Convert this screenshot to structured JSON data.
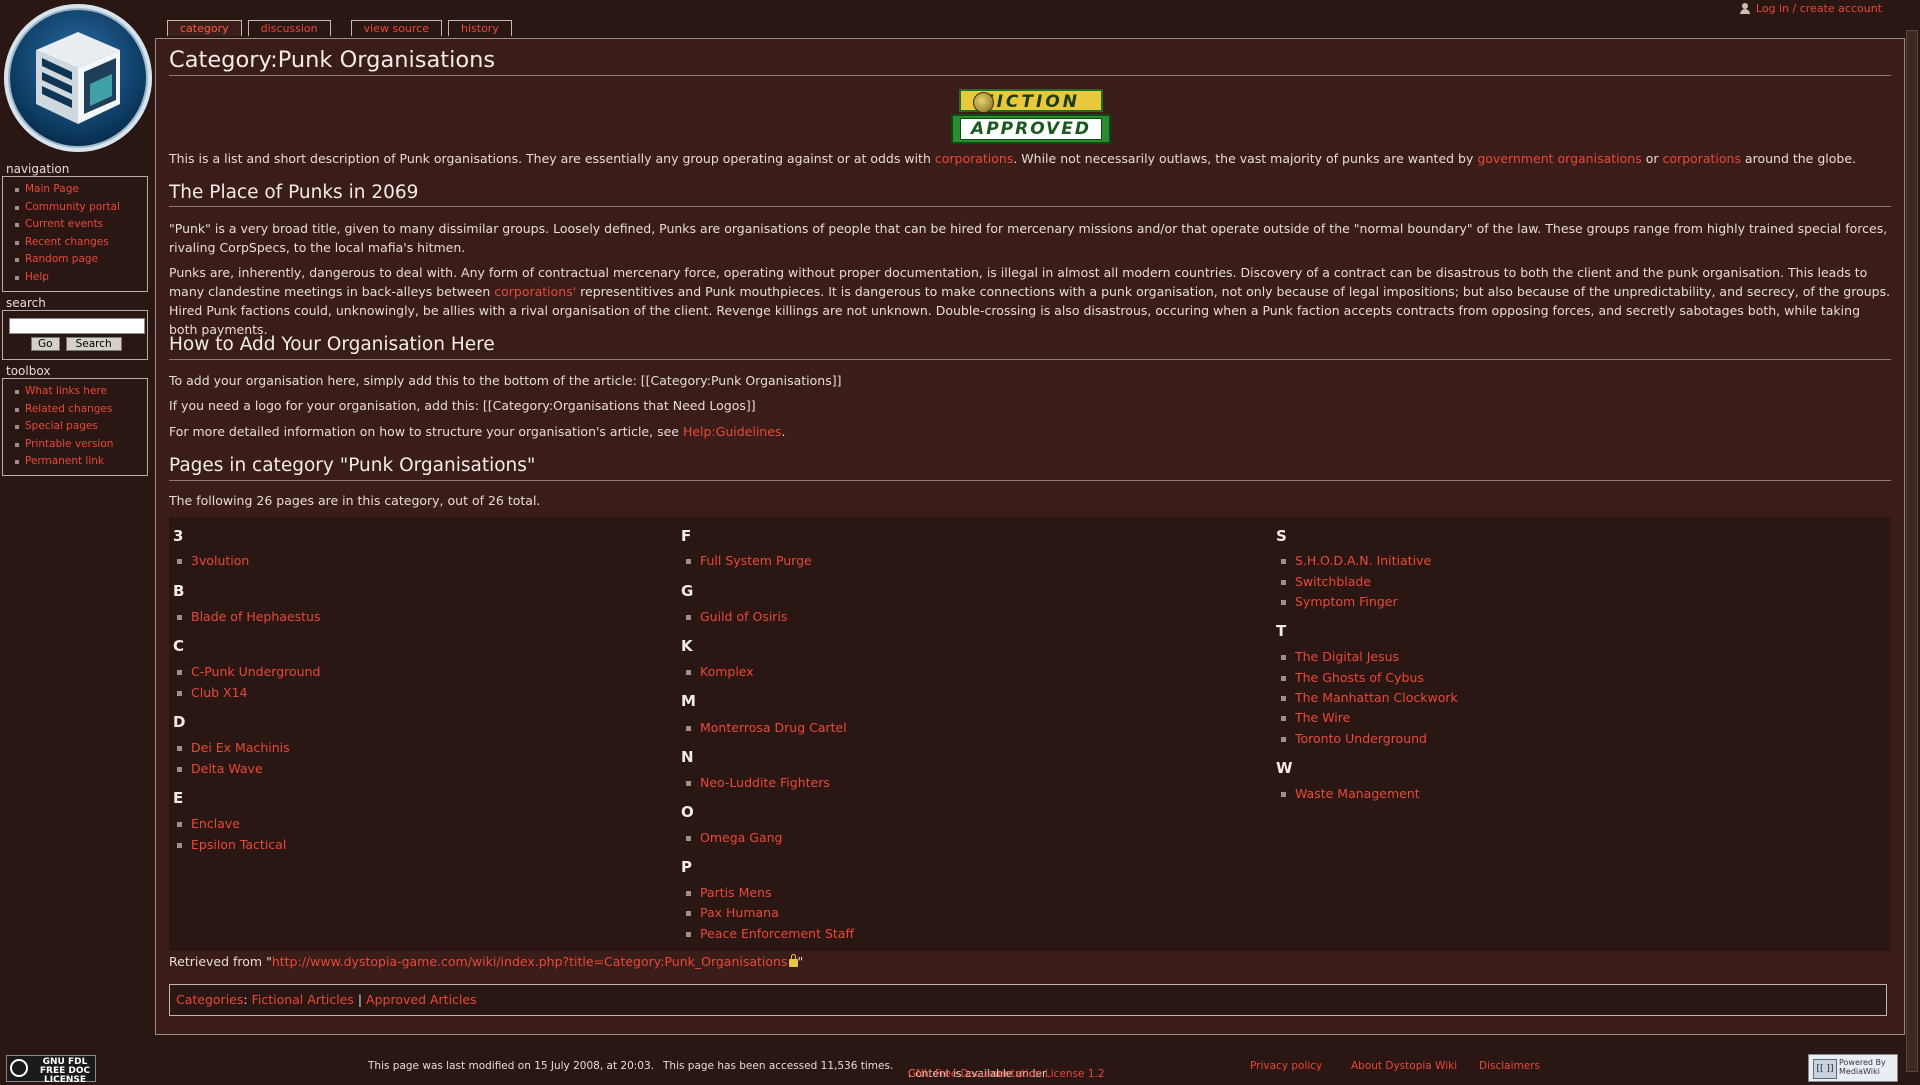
{
  "personal": {
    "login": "Log in / create account"
  },
  "tabs": [
    {
      "label": "category"
    },
    {
      "label": "discussion"
    },
    {
      "label": "view source"
    },
    {
      "label": "history"
    }
  ],
  "sidebar": {
    "navigation_title": "navigation",
    "navigation": [
      "Main Page",
      "Community portal",
      "Current events",
      "Recent changes",
      "Random page",
      "Help"
    ],
    "search_title": "search",
    "go_label": "Go",
    "search_label": "Search",
    "toolbox_title": "toolbox",
    "toolbox": [
      "What links here",
      "Related changes",
      "Special pages",
      "Printable version",
      "Permanent link"
    ]
  },
  "page": {
    "title": "Category:Punk Organisations",
    "badge_top": "FICTION",
    "badge_bottom": "APPROVED",
    "intro_1": "This is a list and short description of Punk organisations. They are essentially any group operating against or at odds with ",
    "intro_link_1": "corporations",
    "intro_2": ". While not necessarily outlaws, the vast majority of punks are wanted by ",
    "intro_link_2": "government organisations",
    "intro_3": " or ",
    "intro_link_3": "corporations",
    "intro_4": " around the globe.",
    "h2_place": "The Place of Punks in 2069",
    "place_p1": "\"Punk\" is a very broad title, given to many dissimilar groups. Loosely defined, Punks are organisations of people that can be hired for mercenary missions and/or that operate outside of the \"normal boundary\" of the law. These groups range from highly trained special forces, rivaling CorpSpecs, to the local mafia's hitmen.",
    "place_p2a": "Punks are, inherently, dangerous to deal with. Any form of contractual mercenary force, operating without proper documentation, is illegal in almost all modern countries. Discovery of a contract can be disastrous to both the client and the punk organisation. This leads to many clandestine meetings in back-alleys between ",
    "place_p2_link": "corporations'",
    "place_p2b": " representitives and Punk mouthpieces. It is dangerous to make connections with a punk organisation, not only because of legal impositions; but also because of the unpredictability, and secrecy, of the groups. Hired Punk factions could, unknowingly, be allies with a rival organisation of the client. Revenge killings are not unknown. Double-crossing is also disastrous, occuring when a Punk faction accepts contracts from opposing forces, and secretly sabotages both, while taking both payments.",
    "h2_howto": "How to Add Your Organisation Here",
    "howto_1": "To add your organisation here, simply add this to the bottom of the article: [[Category:Punk Organisations]]",
    "howto_2": "If you need a logo for your organisation, add this: [[Category:Organisations that Need Logos]]",
    "howto_3a": "For more detailed information on how to structure your organisation's article, see ",
    "howto_3_link": "Help:Guidelines",
    "howto_3b": ".",
    "h2_pages": "Pages in category \"Punk Organisations\"",
    "count_text": "The following 26 pages are in this category, out of 26 total."
  },
  "categories": [
    {
      "groups": [
        {
          "letter": "3",
          "items": [
            "3volution"
          ]
        },
        {
          "letter": "B",
          "items": [
            "Blade of Hephaestus"
          ]
        },
        {
          "letter": "C",
          "items": [
            "C-Punk Underground",
            "Club X14"
          ]
        },
        {
          "letter": "D",
          "items": [
            "Dei Ex Machinis",
            "Delta Wave"
          ]
        },
        {
          "letter": "E",
          "items": [
            "Enclave",
            "Epsilon Tactical"
          ]
        }
      ]
    },
    {
      "groups": [
        {
          "letter": "F",
          "items": [
            "Full System Purge"
          ]
        },
        {
          "letter": "G",
          "items": [
            "Guild of Osiris"
          ]
        },
        {
          "letter": "K",
          "items": [
            "Komplex"
          ]
        },
        {
          "letter": "M",
          "items": [
            "Monterrosa Drug Cartel"
          ]
        },
        {
          "letter": "N",
          "items": [
            "Neo-Luddite Fighters"
          ]
        },
        {
          "letter": "O",
          "items": [
            "Omega Gang"
          ]
        },
        {
          "letter": "P",
          "items": [
            "Partis Mens",
            "Pax Humana",
            "Peace Enforcement Staff"
          ]
        }
      ]
    },
    {
      "groups": [
        {
          "letter": "S",
          "items": [
            "S.H.O.D.A.N. Initiative",
            "Switchblade",
            "Symptom Finger"
          ]
        },
        {
          "letter": "T",
          "items": [
            "The Digital Jesus",
            "The Ghosts of Cybus",
            "The Manhattan Clockwork",
            "The Wire",
            "Toronto Underground"
          ]
        },
        {
          "letter": "W",
          "items": [
            "Waste Management"
          ]
        }
      ]
    }
  ],
  "retrieved": {
    "prefix": "Retrieved from \"",
    "url": "http://www.dystopia-game.com/wiki/index.php?title=Category:Punk_Organisations",
    "suffix": "\""
  },
  "catlinks": {
    "label": "Categories",
    "sep": ": ",
    "pipe": " | ",
    "links": [
      "Fictional Articles",
      "Approved Articles"
    ]
  },
  "footer": {
    "modified": "This page was last modified on 15 July 2008, at 20:03.",
    "accessed": "This page has been accessed 11,536 times.",
    "license_prefix": "Content is available under ",
    "license_link": "GNU Free Documentation License 1.2",
    "license_suffix": ".",
    "privacy": "Privacy policy",
    "about": "About Dystopia Wiki",
    "disclaimers": "Disclaimers",
    "gnu_badge": "GNU FDL FREE DOC LICENSE",
    "mw_badge": "Powered By MediaWiki"
  }
}
